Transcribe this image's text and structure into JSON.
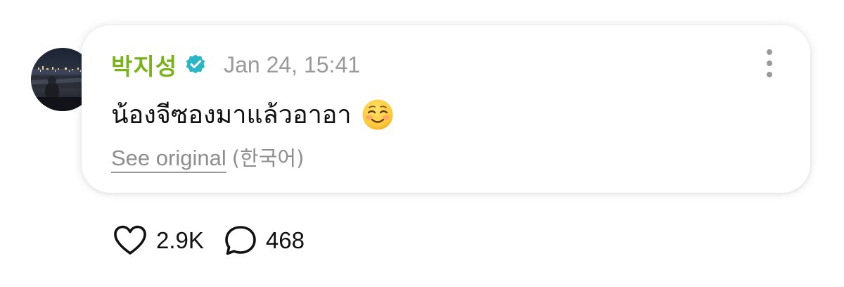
{
  "post": {
    "username": "박지성",
    "verified_icon": "verified-badge-icon",
    "timestamp": "Jan 24, 15:41",
    "message": "น้องจีซองมาแล้วอาอา",
    "emoji": "☺️",
    "see_original_label": "See original",
    "original_language": "(한국어)",
    "more_icon": "more-vertical-icon"
  },
  "actions": {
    "like_icon": "heart-icon",
    "like_count": "2.9K",
    "comment_icon": "comment-bubble-icon",
    "comment_count": "468"
  },
  "colors": {
    "username": "#7ab317",
    "verified_badge": "#29b7c5",
    "muted_text": "#9a9a9a",
    "primary_text": "#111111",
    "card_background": "#ffffff"
  }
}
